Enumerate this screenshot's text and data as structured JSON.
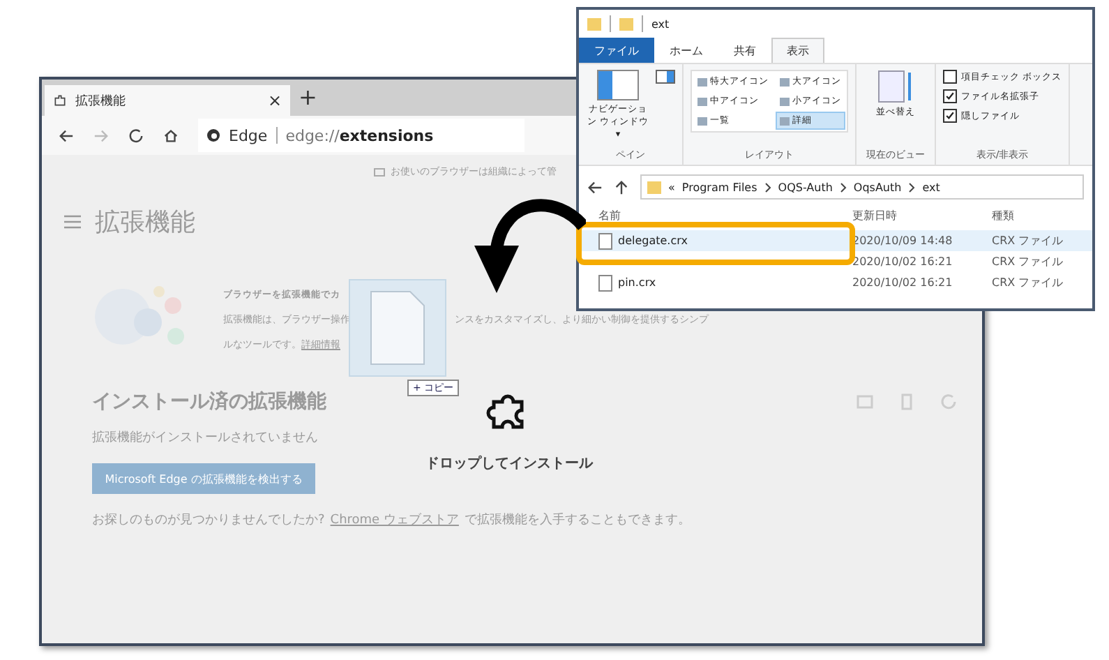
{
  "browser": {
    "tab_title": "拡張機能",
    "tab_close": "×",
    "new_tab": "+",
    "address": {
      "site": "Edge",
      "url_prefix": "edge://",
      "url_path": "extensions"
    },
    "banner": "お使いのブラウザーは組織によって管",
    "page_title": "拡張機能",
    "promo": {
      "heading": "ブラウザーを拡張機能でカ",
      "line_2_start": "拡張機能は、ブラウザー操作",
      "line_2_end": "ンスをカスタマイズし、より細かい制御を提供するシンプ",
      "line_3": "ルなツールです。",
      "link": "詳細情報"
    },
    "installed_heading": "インストール済の拡張機能",
    "empty_text": "拡張機能がインストールされていません",
    "find_button": "Microsoft Edge の拡張機能を検出する",
    "footer": {
      "before": "お探しのものが見つかりませんでしたか?",
      "link": "Chrome ウェブストア",
      "after": "で拡張機能を入手することもできます。"
    },
    "drop_label": "ドロップしてインストール",
    "drag_badge": "+ コピー"
  },
  "explorer": {
    "title": "ext",
    "tabs": [
      {
        "label": "ファイル",
        "kind": "file",
        "selected": false
      },
      {
        "label": "ホーム",
        "kind": "tab",
        "selected": false
      },
      {
        "label": "共有",
        "kind": "tab",
        "selected": false
      },
      {
        "label": "表示",
        "kind": "tab",
        "selected": true
      }
    ],
    "pane_group": {
      "label": "ペイン",
      "button": "ナビゲーション ウィンドウ▾"
    },
    "layout_group": {
      "label": "レイアウト",
      "items": [
        {
          "label": "特大アイコン",
          "selected": false
        },
        {
          "label": "大アイコン",
          "selected": false
        },
        {
          "label": "中アイコン",
          "selected": false
        },
        {
          "label": "小アイコン",
          "selected": false
        },
        {
          "label": "一覧",
          "selected": false
        },
        {
          "label": "詳細",
          "selected": true
        }
      ]
    },
    "view_group": {
      "label": "現在のビュー",
      "sort_button": "並べ替え"
    },
    "show_group": {
      "label": "表示/非表示",
      "options": [
        {
          "label": "項目チェック ボックス",
          "checked": false
        },
        {
          "label": "ファイル名拡張子",
          "checked": true
        },
        {
          "label": "隠しファイル",
          "checked": true
        }
      ]
    },
    "breadcrumb_overflow": "«",
    "breadcrumb": [
      "Program Files",
      "OQS-Auth",
      "OqsAuth",
      "ext"
    ],
    "columns": [
      "名前",
      "更新日時",
      "種類"
    ],
    "files": [
      {
        "name": "delegate.crx",
        "modified": "2020/10/09 14:48",
        "type": "CRX ファイル",
        "selected": true
      },
      {
        "modified": "2020/10/02 16:21",
        "type": "CRX ファイル",
        "selected": false
      },
      {
        "name": "pin.crx",
        "modified": "2020/10/02 16:21",
        "type": "CRX ファイル",
        "selected": false
      }
    ]
  }
}
